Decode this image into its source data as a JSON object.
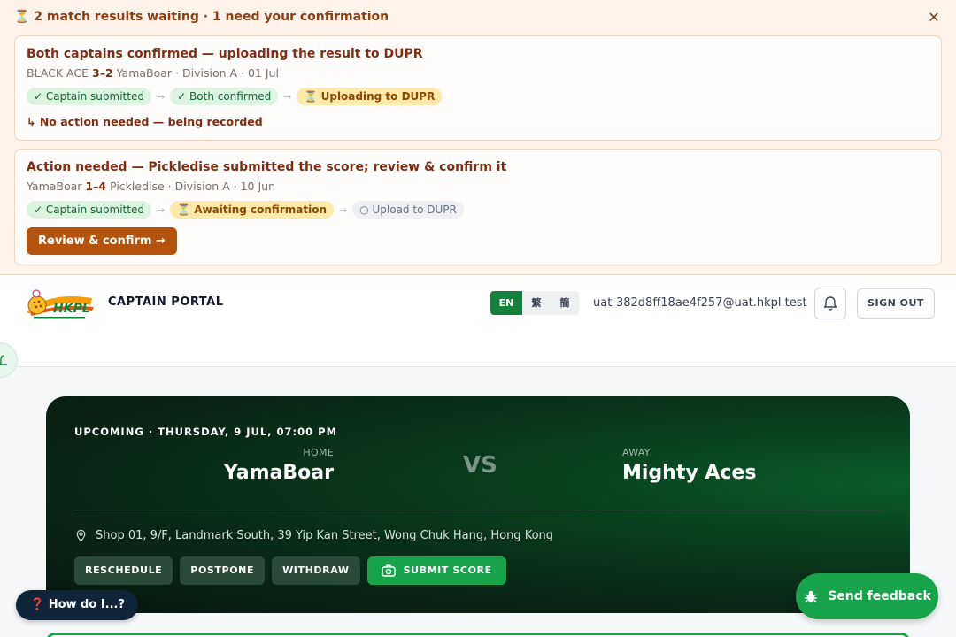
{
  "banner": {
    "icon": "hourglass-icon",
    "heading": "⏳ 2 match results waiting · 1 need your confirmation",
    "close_symbol": "✕",
    "cards": [
      {
        "title": "Both captains confirmed — uploading the result to DUPR",
        "home_team": "BLACK ACE",
        "score": "3–2",
        "away_team": "YamaBoar",
        "meta_suffix": "· Division A · 01 Jul",
        "steps": [
          {
            "label": "✓ Captain submitted",
            "state": "done"
          },
          {
            "label": "✓ Both confirmed",
            "state": "done"
          },
          {
            "label": "⏳ Uploading to DUPR",
            "state": "active"
          }
        ],
        "note": "↳ No action needed — being recorded"
      },
      {
        "title": "Action needed — Pickledise submitted the score; review & confirm it",
        "home_team": "YamaBoar",
        "score": "1–4",
        "away_team": "Pickledise",
        "meta_suffix": "· Division A · 10 Jun",
        "steps": [
          {
            "label": "✓ Captain submitted",
            "state": "done"
          },
          {
            "label": "⏳ Awaiting confirmation",
            "state": "active"
          },
          {
            "label": "○ Upload to DUPR",
            "state": "pending"
          }
        ],
        "button_label": "Review & confirm →"
      }
    ]
  },
  "header": {
    "logo_text": "HKPL",
    "portal_title": "CAPTAIN PORTAL",
    "languages": [
      {
        "label": "EN",
        "active": true
      },
      {
        "label": "繁",
        "active": false
      },
      {
        "label": "簡",
        "active": false
      }
    ],
    "user_email": "uat-382d8ff18ae4f257@uat.hkpl.test",
    "bell_icon": "bell-icon",
    "sign_out": "SIGN OUT"
  },
  "match": {
    "status": "UPCOMING · THURSDAY, 9 JUL, 07:00 PM",
    "home_role": "HOME",
    "home_team": "YamaBoar",
    "vs": "VS",
    "away_role": "AWAY",
    "away_team": "Mighty Aces",
    "venue": "Shop 01, 9/F, Landmark South, 39 Yip Kan Street, Wong Chuk Hang, Hong Kong",
    "actions": {
      "reschedule": "RESCHEDULE",
      "postpone": "POSTPONE",
      "withdraw": "WITHDRAW",
      "submit": "SUBMIT SCORE"
    }
  },
  "floating": {
    "help": "❓ How do I...?",
    "feedback": "Send feedback"
  },
  "colors": {
    "brand_green": "#16a34a",
    "banner_bg": "#fdf3ea",
    "warning_brown": "#b4530e",
    "help_navy": "#0f2437"
  }
}
